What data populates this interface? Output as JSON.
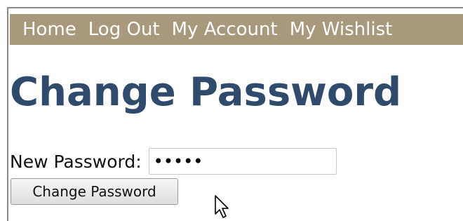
{
  "nav": {
    "items": [
      {
        "label": "Home"
      },
      {
        "label": "Log Out"
      },
      {
        "label": "My Account"
      },
      {
        "label": "My Wishlist"
      }
    ],
    "background_color": "#a8987c"
  },
  "page": {
    "title": "Change Password",
    "title_color": "#2f4a6a"
  },
  "form": {
    "new_password_label": "New Password:",
    "new_password_value": "•••••",
    "submit_label": "Change Password"
  },
  "cursor": {
    "icon": "mouse-pointer-icon"
  }
}
